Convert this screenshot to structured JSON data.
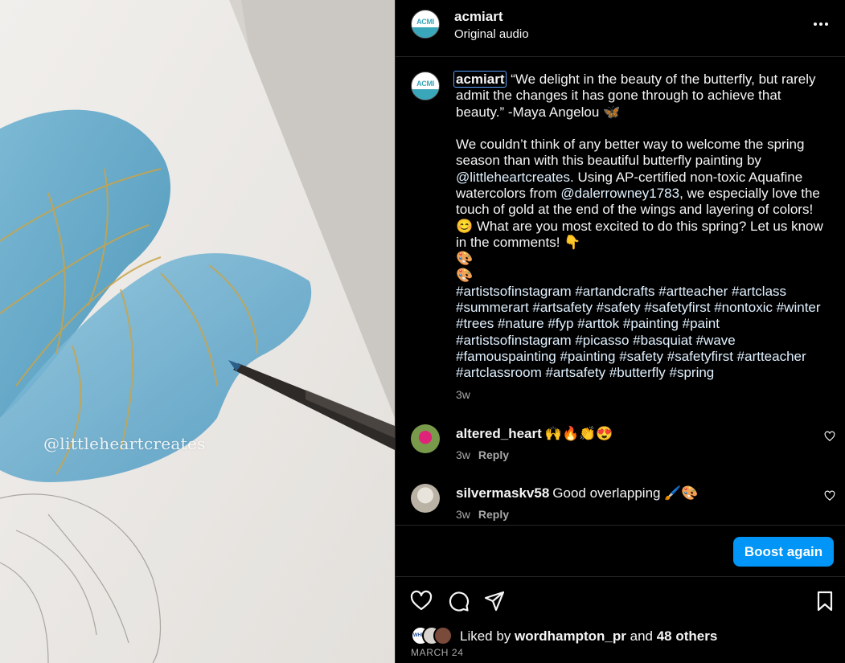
{
  "media": {
    "watermark": "@littleheartcreates"
  },
  "header": {
    "username": "acmiart",
    "audio": "Original audio",
    "avatar_text": "ACMI"
  },
  "caption": {
    "username": "acmiart",
    "line1": "“We delight in the beauty of the butterfly, but rarely admit the changes it has gone through to achieve that beauty.” -Maya Angelou 🦋",
    "para2_a": "We couldn’t think of any better way to welcome the spring season than with this beautiful butterfly painting by ",
    "mention1": "@littleheartcreates",
    "para2_b": ". Using AP-certified non-toxic Aquafine watercolors from ",
    "mention2": "@dalerrowney1783",
    "para2_c": ", we especially love the touch of gold at the end of the wings and layering of colors! 😊 What are you most excited to do this spring? Let us know in the comments! 👇",
    "emoji1": "🎨",
    "emoji2": "🎨",
    "hashtags": "#artistsofinstagram #artandcrafts #artteacher #artclass #summerart #artsafety #safety #safetyfirst #nontoxic #winter #trees #nature #fyp #arttok #painting #paint #artistsofinstagram #picasso #basquiat #wave #famouspainting #painting #safety #safetyfirst #artteacher #artclassroom #artsafety #butterfly #spring",
    "time": "3w"
  },
  "comments": [
    {
      "username": "altered_heart",
      "text": "🙌🔥👏😍",
      "time": "3w",
      "reply": "Reply"
    },
    {
      "username": "silvermaskv58",
      "text": "Good overlapping 🖌️🎨",
      "time": "3w",
      "reply": "Reply"
    }
  ],
  "boost": {
    "label": "Boost again"
  },
  "likes": {
    "prefix": "Liked by ",
    "user": "wordhampton_pr",
    "middle": " and ",
    "others": "48 others",
    "avatar1_text": "WHPR"
  },
  "date": "MARCH 24",
  "colors": {
    "accent": "#0095f6",
    "background": "#000000",
    "secondary_text": "#a8a8a8",
    "link": "#e0f1ff"
  },
  "icons": [
    "more-icon",
    "heart-icon",
    "comment-icon",
    "share-icon",
    "bookmark-icon"
  ]
}
